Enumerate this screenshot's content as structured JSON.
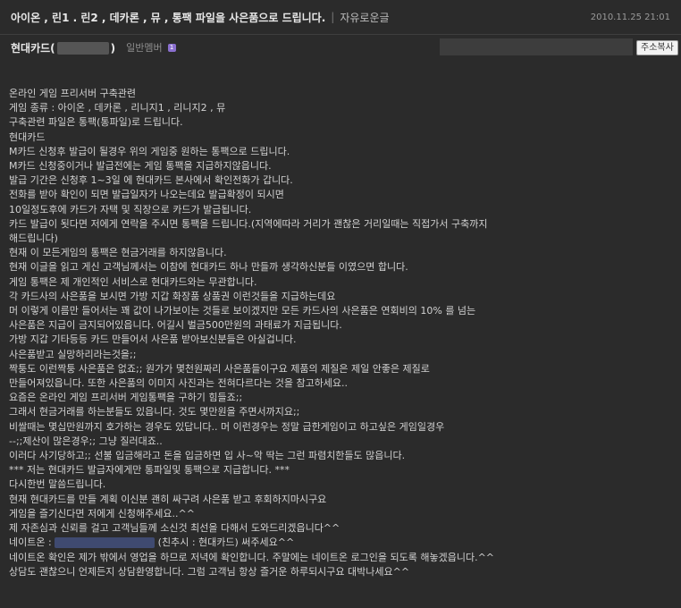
{
  "post": {
    "title": "아이온 , 린1 . 린2 , 데카론 , 뮤 , 통팩 파일을 사은품으로 드립니다.",
    "separator": "|",
    "category": "자유로운글",
    "date": "2010.11.25 21:01"
  },
  "author": {
    "name_prefix": "현대카드(",
    "name_suffix": ")",
    "level": "일반멤버",
    "level_icon": "member-level-icon",
    "copy_button": "주소복사"
  },
  "body": {
    "lines": [
      "온라인 게임 프리서버 구축관련",
      "게임 종류 : 아이온 , 데카론 , 리니지1 , 리니지2 , 뮤",
      "구축관련 파일은 통팩(통파일)로 드립니다.",
      "현대카드",
      "M카드 신청후 발급이 될경우  위의 게임중 원하는 통팩으로 드립니다.",
      "M카드 신청중이거나 발급전에는 게임 통팩을 지급하지않읍니다.",
      "발급 기간은 신청후 1~3일 에 현대카드 본사에서 확인전화가 갑니다.",
      "전화를 받아 확인이 되면 발급일자가 나오는데요 발급확정이 되시면",
      "10일정도후에 카드가 자택 및 직장으로 카드가 발급됩니다.",
      "카드 발급이 됫다면 저에게 연락을 주시면 통팩을 드립니다.(지역에따라 거리가 괜찮은 거리일때는 직접가서 구축까지",
      "해드립니다)",
      "현재 이 모든게임의 통팩은 현금거래를 하지않읍니다.",
      "현재 이글을 읽고 게신 고객님께서는 이참에 현대카드 하나 만들까 생각하신분들 이였으면 합니다.",
      "게임 통팩은 제 개인적인 서비스로 현대카드와는 무관합니다.",
      "각 카드사의 사은품을 보시면 가방 지갑 화장품 상품권 이런것들을 지급하는데요",
      "머 이렇게 이름만 들어서는 꽤 값이 나가보이는 것들로 보이겠지만 모든 카드사의 사은품은 연회비의 10% 를 넘는",
      "사은품은 지급이 금지되어있읍니다. 어길시 벌금500만원의 과태료가 지급됩니다.",
      "가방 지갑 기타등등 카드 만들어서 사은품 받아보신분들은 아실겁니다.",
      "사은품받고 실망하리라는것을;;",
      "짝퉁도 이런짝퉁 사은품은 없죠;; 원가가 몇천원짜리 사은품들이구요 제품의 제질은 제일 안좋은 제질로",
      "만들어져있읍니다. 또한 사은품의 이미지 사진과는 전혀다르다는 것을 참고하세요..",
      "요즘은 온라인 게임 프리서버 게임통팩을 구하기 힘들죠;;",
      "그래서 현금거래를 하는분들도 있읍니다. 것도 몇만원을 주면서까지요;;",
      "비쌀때는 몇십만원까지 호가하는 경우도 있답니다.. 머 이런경우는 정말 급한게임이고 하고싶은 게임일경우",
      "--;;제산이 많은경우;; 그냥 질러대죠..",
      "이러다 사기당하고;; 선불 입금해라고 돈을 입금하면 입 사~악 딱는 그런 파렴치한들도 많읍니다.",
      "*** 저는 현대카드 발급자에게만 통파일및 통팩으로 지급합니다. ***",
      "다시한번 말씀드립니다.",
      "현재 현대카드를 만들 계획 이신분 괜히 싸구려 사은품 받고 후회하지마시구요",
      "게임을 즐기신다면 저에게 신청해주세요..^^",
      "제 자존심과 신뢰를 걸고 고객님들께 소신것 최선을 다해서 도와드리겠읍니다^^"
    ],
    "nateon_prefix": "네이트온 : ",
    "nateon_suffix": " (친추시 : 현대카드) 써주세요^^",
    "tail_lines": [
      "네이트온 확인은 제가 밖에서 영업을 하므로 저녁에 확인합니다. 주말에는 네이트온 로그인을 되도록 해놓겠읍니다.^^",
      "상담도 괜찮으니 언제든지 상담환영합니다. 그럼 고객님 항상 즐거운 하루되시구요 대박나세요^^"
    ]
  },
  "colors": {
    "background": "#2b2b2b",
    "text": "#d2d2d2",
    "title": "#e8e8e8",
    "level_badge": "#8a6fcf",
    "link_mask": "#3f4a70"
  }
}
